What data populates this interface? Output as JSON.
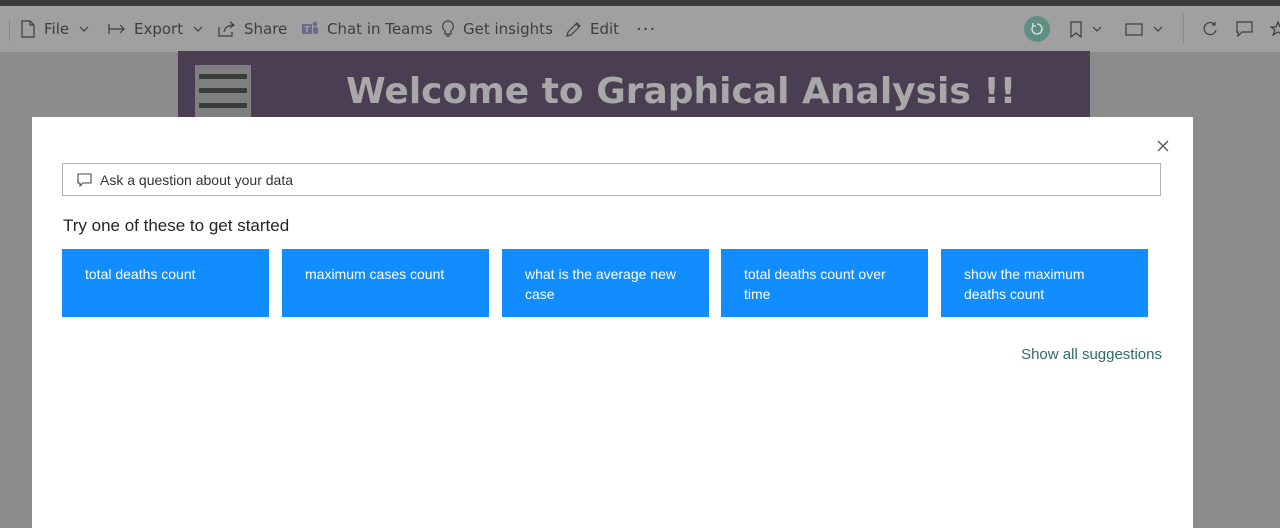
{
  "toolbar": {
    "file_label": "File",
    "export_label": "Export",
    "share_label": "Share",
    "teams_label": "Chat in Teams",
    "insights_label": "Get insights",
    "edit_label": "Edit",
    "more_label": "···"
  },
  "report": {
    "title": "Welcome to Graphical Analysis !!"
  },
  "qa_dialog": {
    "input_placeholder": "Ask a question about your data",
    "heading": "Try one of these to get started",
    "suggestions": [
      "total deaths count",
      "maximum cases count",
      "what is the average new case",
      "total deaths count over time",
      "show the maximum deaths count"
    ],
    "show_all_label": "Show all suggestions"
  },
  "colors": {
    "chip_blue": "#118dff",
    "link_teal": "#2f6a66",
    "banner_purple": "#4a3f52"
  }
}
